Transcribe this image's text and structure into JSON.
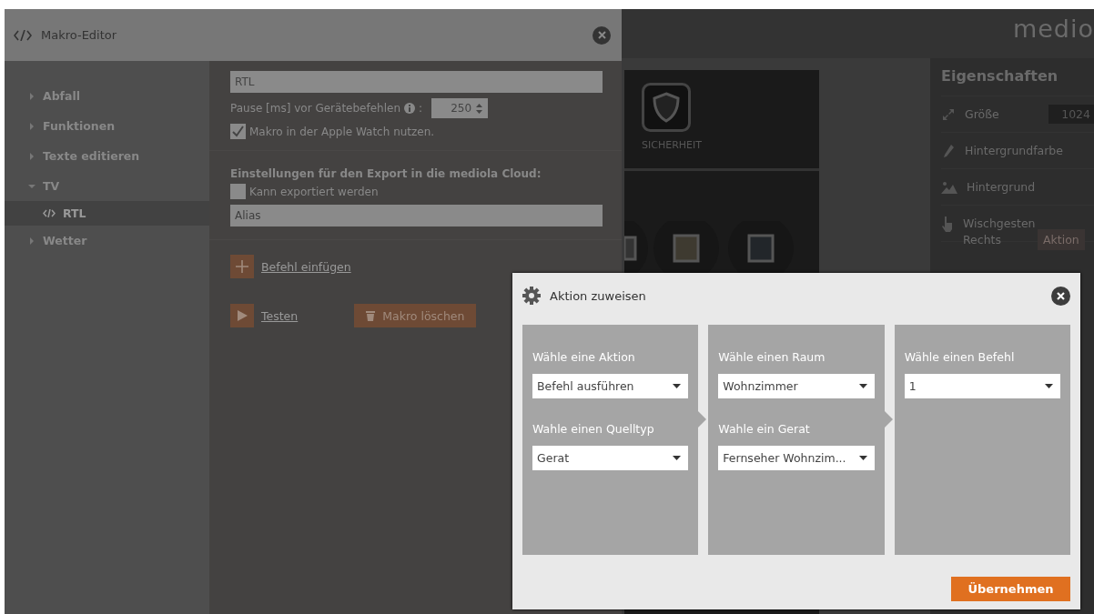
{
  "editor": {
    "title": "Makro-Editor",
    "tree": [
      {
        "label": "Abfall",
        "expanded": false,
        "selected": false
      },
      {
        "label": "Funktionen",
        "expanded": false,
        "selected": false
      },
      {
        "label": "Texte editieren",
        "expanded": false,
        "selected": false
      },
      {
        "label": "TV",
        "expanded": true,
        "selected": false,
        "children": [
          {
            "label": "RTL",
            "selected": true
          }
        ]
      },
      {
        "label": "Wetter",
        "expanded": false,
        "selected": false
      }
    ],
    "name_value": "RTL",
    "pause_label": "Pause [ms] vor Gerätebefehlen",
    "pause_colon": ":",
    "pause_value": "250",
    "apple_watch": {
      "label": "Makro in der Apple Watch nutzen.",
      "checked": true
    },
    "export_heading": "Einstellungen für den Export in die mediola Cloud:",
    "export_checkbox": {
      "label": "Kann exportiert werden",
      "checked": false
    },
    "alias_placeholder": "Alias",
    "insert_command": "Befehl einfügen",
    "test": "Testen",
    "delete": "Makro löschen"
  },
  "app": {
    "logo": "medio",
    "tile_label": "SICHERHEIT",
    "properties": {
      "title": "Eigenschaften",
      "rows": [
        {
          "kind": "size",
          "label": "Größe",
          "value": "1024"
        },
        {
          "kind": "color",
          "label": "Hintergrundfarbe"
        },
        {
          "kind": "image",
          "label": "Hintergrund"
        },
        {
          "kind": "gesture",
          "label": "Wischgesten"
        }
      ],
      "sub_label": "Rechts",
      "sub_button": "Aktion"
    }
  },
  "dialog": {
    "title": "Aktion zuweisen",
    "columns": [
      {
        "fields": [
          {
            "label": "Wähle eine Aktion",
            "value": "Befehl ausführen"
          },
          {
            "label": "Wahle einen Quelltyp",
            "value": "Gerat"
          }
        ]
      },
      {
        "fields": [
          {
            "label": "Wähle einen Raum",
            "value": "Wohnzimmer"
          },
          {
            "label": "Wahle ein Gerat",
            "value": "Fernseher Wohnzim..."
          }
        ]
      },
      {
        "fields": [
          {
            "label": "Wähle einen Befehl",
            "value": "1"
          }
        ]
      }
    ],
    "button": "Übernehmen"
  }
}
